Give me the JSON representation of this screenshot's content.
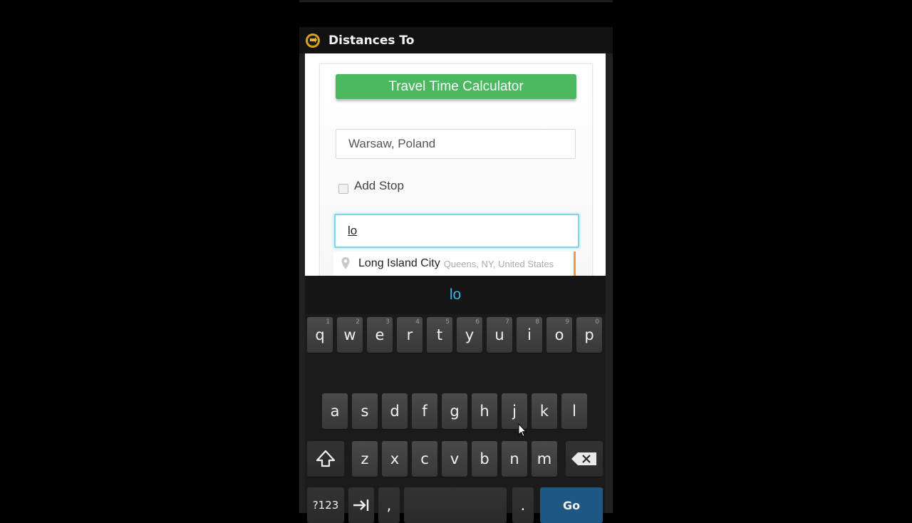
{
  "app": {
    "title": "Distances To",
    "icon": "app-logo-icon"
  },
  "form": {
    "calculator_button": "Travel Time Calculator",
    "origin_value": "Warsaw, Poland",
    "add_stop_label": "Add Stop",
    "add_stop_checked": false,
    "destination_value": "lo",
    "suggestion": {
      "main": "Long Island City",
      "secondary": "Queens, NY, United States",
      "icon": "map-pin-icon"
    }
  },
  "keyboard": {
    "candidate": "lo",
    "row1": [
      {
        "label": "q",
        "hint": "1"
      },
      {
        "label": "w",
        "hint": "2"
      },
      {
        "label": "e",
        "hint": "3"
      },
      {
        "label": "r",
        "hint": "4"
      },
      {
        "label": "t",
        "hint": "5"
      },
      {
        "label": "y",
        "hint": "6"
      },
      {
        "label": "u",
        "hint": "7"
      },
      {
        "label": "i",
        "hint": "8"
      },
      {
        "label": "o",
        "hint": "9"
      },
      {
        "label": "p",
        "hint": "0"
      }
    ],
    "row2": [
      "a",
      "s",
      "d",
      "f",
      "g",
      "h",
      "j",
      "k",
      "l"
    ],
    "row3": [
      "z",
      "x",
      "c",
      "v",
      "b",
      "n",
      "m"
    ],
    "symbols_label": "?123",
    "comma_label": ",",
    "period_label": ".",
    "go_label": "Go",
    "shift_icon": "shift-arrow-icon",
    "backspace_icon": "backspace-icon",
    "tab_icon": "tab-arrow-icon"
  },
  "colors": {
    "accent_green": "#4cb860",
    "focus_blue": "#7fd4ec",
    "candidate_text": "#33b5e5",
    "go_key": "#1e5782"
  }
}
